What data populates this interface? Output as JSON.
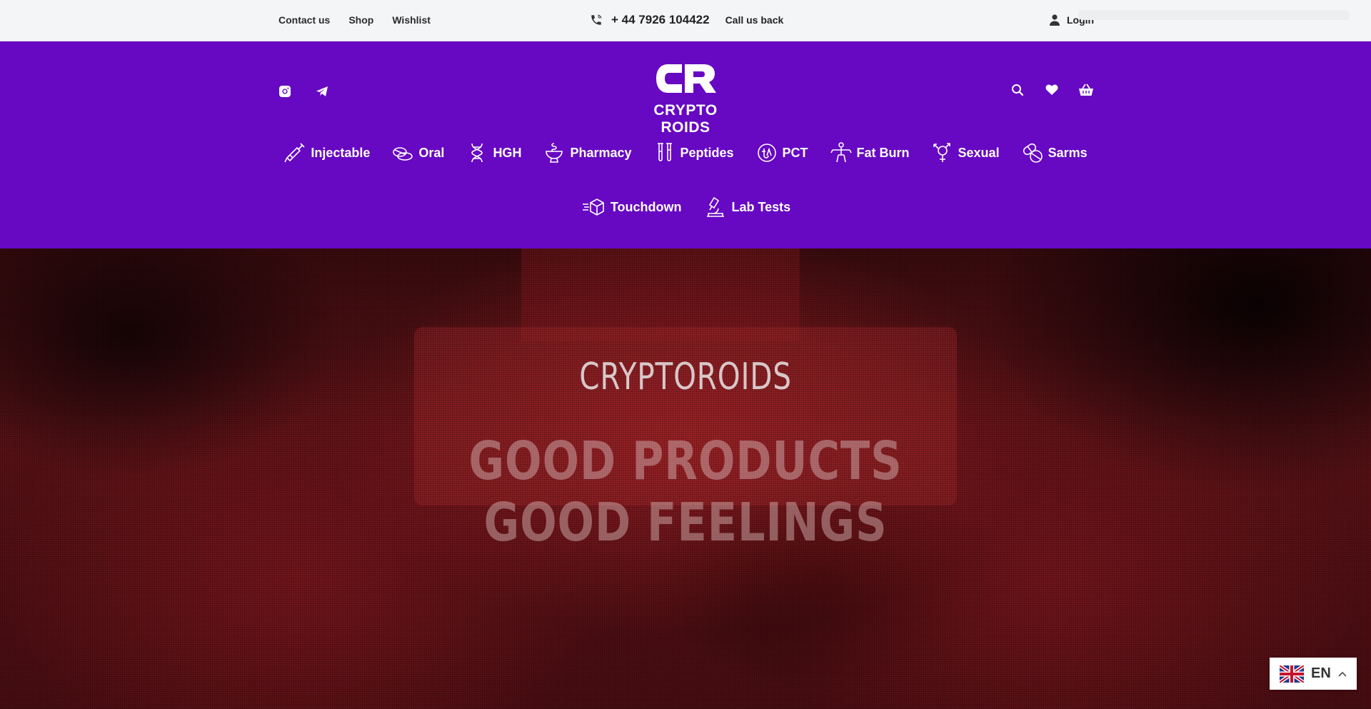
{
  "topbar": {
    "links": [
      "Contact us",
      "Shop",
      "Wishlist"
    ],
    "phone": "+ 44 7926 104422",
    "callback": "Call us back",
    "login": "Login"
  },
  "header": {
    "logo_text": "CRYPTO ROIDS",
    "social": [
      "instagram-icon",
      "telegram-icon"
    ],
    "actions": [
      "search-icon",
      "heart-icon",
      "basket-icon"
    ],
    "brand_color": "#6708c3"
  },
  "nav": {
    "row1": [
      {
        "label": "Injectable",
        "icon": "syringe-icon"
      },
      {
        "label": "Oral",
        "icon": "pills-icon"
      },
      {
        "label": "HGH",
        "icon": "dna-icon"
      },
      {
        "label": "Pharmacy",
        "icon": "pharmacy-icon"
      },
      {
        "label": "Peptides",
        "icon": "test-tubes-icon"
      },
      {
        "label": "PCT",
        "icon": "pct-icon"
      },
      {
        "label": "Fat Burn",
        "icon": "body-icon"
      },
      {
        "label": "Sexual",
        "icon": "gender-icon"
      },
      {
        "label": "Sarms",
        "icon": "capsules-icon"
      }
    ],
    "row2": [
      {
        "label": "Touchdown",
        "icon": "fast-box-icon"
      },
      {
        "label": "Lab Tests",
        "icon": "microscope-icon"
      }
    ]
  },
  "hero": {
    "eyebrow": "CRYPTOROIDS",
    "headline_line1": "GOOD PRODUCTS",
    "headline_line2": "GOOD FEELINGS"
  },
  "language": {
    "code": "EN"
  }
}
